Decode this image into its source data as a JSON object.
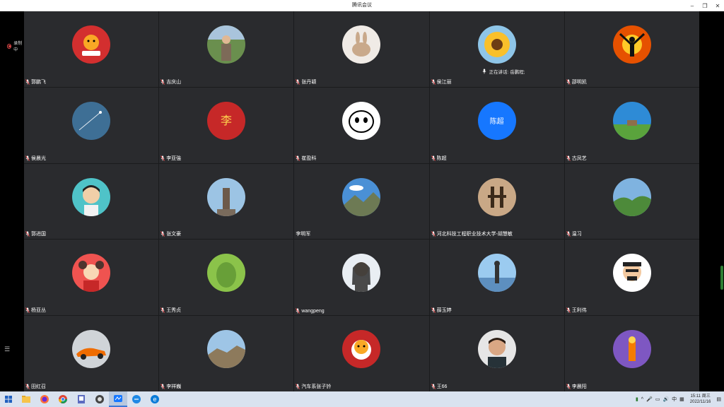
{
  "window": {
    "title": "腾讯会议",
    "minimize": "–",
    "maximize": "❐",
    "close": "✕"
  },
  "recording": {
    "label": "录制中"
  },
  "speaking": {
    "label": "正在讲话: 岳鹏程;"
  },
  "participants": [
    {
      "name": "郭鹏飞",
      "avatar_kind": "tiger-2022",
      "muted": true
    },
    {
      "name": "吉庆山",
      "avatar_kind": "person-outdoors",
      "muted": true
    },
    {
      "name": "张丹颖",
      "avatar_kind": "rabbit",
      "muted": true
    },
    {
      "name": "侯江丽",
      "avatar_kind": "sunflower",
      "muted": true
    },
    {
      "name": "邵明凯",
      "avatar_kind": "silhouette-sunset",
      "muted": true
    },
    {
      "name": "侯晨光",
      "avatar_kind": "blue-jet",
      "muted": true
    },
    {
      "name": "李亚強",
      "avatar_kind": "red-li-character",
      "muted": true
    },
    {
      "name": "崔盈科",
      "avatar_kind": "cartoon-face",
      "muted": true
    },
    {
      "name": "陈超",
      "avatar_kind": "text",
      "avatar_text": "陈超",
      "muted": true
    },
    {
      "name": "古凤艺",
      "avatar_kind": "sky-field",
      "muted": true
    },
    {
      "name": "郭进国",
      "avatar_kind": "child-portrait",
      "muted": true
    },
    {
      "name": "张文豪",
      "avatar_kind": "statue",
      "muted": true
    },
    {
      "name": "李明军",
      "avatar_kind": "mountain-sky",
      "muted": false
    },
    {
      "name": "河北科技工程职业技术大学-胡慧敏",
      "avatar_kind": "abacus-pattern",
      "muted": true
    },
    {
      "name": "温习",
      "avatar_kind": "green-hills",
      "muted": true
    },
    {
      "name": "杨亚丛",
      "avatar_kind": "girl-red",
      "muted": true
    },
    {
      "name": "王秀贞",
      "avatar_kind": "green-leaf",
      "muted": true
    },
    {
      "name": "wangpeng",
      "avatar_kind": "woman-portrait",
      "muted": true
    },
    {
      "name": "薛玉婷",
      "avatar_kind": "beach-person",
      "muted": true
    },
    {
      "name": "王利伟",
      "avatar_kind": "cartoon-man",
      "muted": true
    },
    {
      "name": "田红召",
      "avatar_kind": "orange-car",
      "muted": true
    },
    {
      "name": "李祥巍",
      "avatar_kind": "great-wall",
      "muted": true
    },
    {
      "name": "汽车系张子钤",
      "avatar_kind": "tiger-cartoon",
      "muted": true
    },
    {
      "name": "王66",
      "avatar_kind": "man-portrait",
      "muted": true
    },
    {
      "name": "李晨阳",
      "avatar_kind": "purple-scene",
      "muted": true
    }
  ],
  "taskbar": {
    "apps": [
      "file-explorer",
      "firefox",
      "chrome",
      "photo-app",
      "app-icon",
      "tencent-meeting",
      "web-app",
      "edge"
    ],
    "tray": {
      "ime": "中",
      "time": "15:11 周三",
      "date": "2022/11/16"
    }
  },
  "colors": {
    "tile_bg": "#2a2b2e",
    "grid_gap": "#1a1b1d",
    "accent": "#1677ff"
  }
}
